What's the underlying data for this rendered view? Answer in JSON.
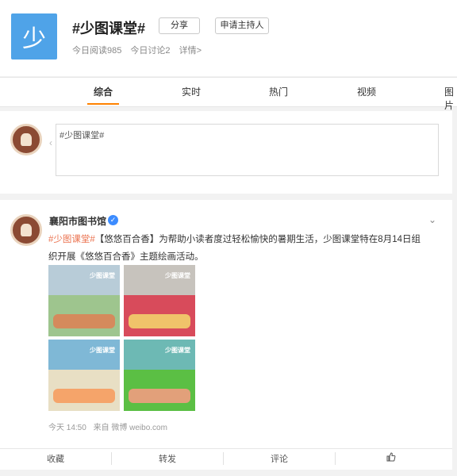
{
  "topic": {
    "logo_char": "少",
    "title": "#少图课堂#",
    "share_label": "分享",
    "apply_host_label": "申请主持人",
    "reads": "今日阅读985",
    "discussions": "今日讨论2",
    "details": "详情>"
  },
  "tabs": [
    {
      "label": "综合",
      "active": true
    },
    {
      "label": "实时"
    },
    {
      "label": "热门"
    },
    {
      "label": "视频"
    },
    {
      "label": "图片"
    }
  ],
  "composer": {
    "value": "#少图课堂#"
  },
  "post": {
    "author": "襄阳市图书馆",
    "verified_icon": "verified-badge-icon",
    "hashtag": "#少图课堂#",
    "text": "【悠悠百合香】为帮助小读者度过轻松愉快的暑期生活，少图课堂特在8月14日组织开展《悠悠百合香》主题绘画活动。",
    "photos": [
      {
        "label": "少图课堂"
      },
      {
        "label": "少图课堂"
      },
      {
        "label": "少图课堂"
      },
      {
        "label": "少图课堂"
      }
    ],
    "time": "今天 14:50",
    "source": "来自 微博 weibo.com"
  },
  "actions": {
    "favorite": "收藏",
    "repost": "转发",
    "comment": "评论",
    "like_icon": "thumbs-up-icon"
  },
  "colors": {
    "accent": "#ff8200",
    "hashtag": "#eb7350",
    "verified": "#3c8cff"
  }
}
